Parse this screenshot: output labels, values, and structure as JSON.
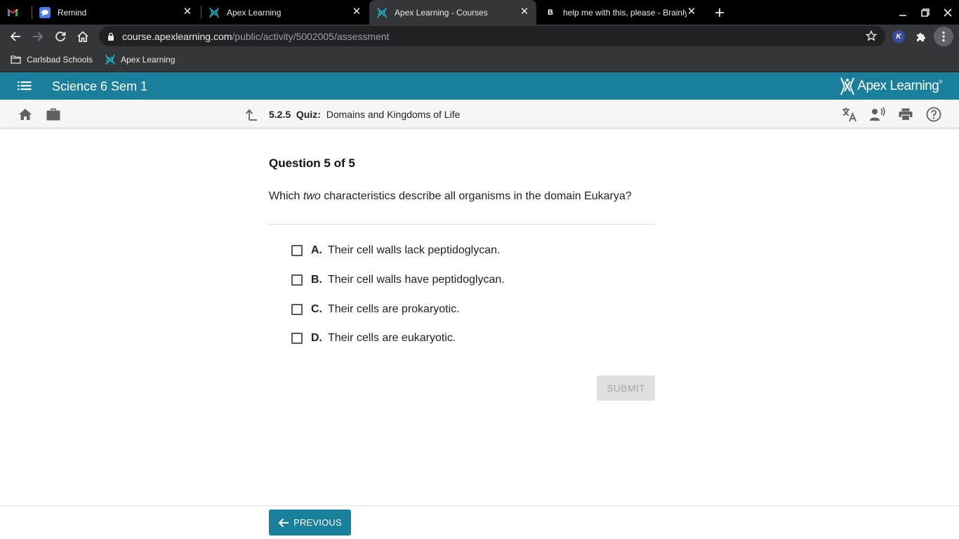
{
  "browser": {
    "tabs": [
      {
        "title": "",
        "icon": "gmail-icon"
      },
      {
        "title": "Remind",
        "icon": "remind-icon"
      },
      {
        "title": "Apex Learning",
        "icon": "apex-icon"
      },
      {
        "title": "Apex Learning - Courses",
        "icon": "apex-icon"
      },
      {
        "title": "help me with this, please - Brainly",
        "icon": "brainly-icon"
      }
    ],
    "url_host": "course.apexlearning.com",
    "url_path": "/public/activity/5002005/assessment",
    "bookmarks": [
      {
        "label": "Carlsbad Schools",
        "icon": "folder-icon"
      },
      {
        "label": "Apex Learning",
        "icon": "apex-icon"
      }
    ]
  },
  "app": {
    "course_title": "Science 6 Sem 1",
    "brand": "Apex Learning",
    "accent": "#1a7f9b"
  },
  "breadcrumb": {
    "number": "5.2.5",
    "type": "Quiz:",
    "title": "Domains and Kingdoms of Life"
  },
  "question": {
    "header": "Question 5 of 5",
    "text_before": "Which ",
    "text_emphasis": "two",
    "text_after": " characteristics describe all organisms in the domain Eukarya?",
    "options": [
      {
        "letter": "A.",
        "text": "Their cell walls lack peptidoglycan."
      },
      {
        "letter": "B.",
        "text": "Their cell walls have peptidoglycan."
      },
      {
        "letter": "C.",
        "text": "Their cells are prokaryotic."
      },
      {
        "letter": "D.",
        "text": "Their cells are eukaryotic."
      }
    ],
    "submit_label": "SUBMIT"
  },
  "footer": {
    "previous_label": "PREVIOUS"
  }
}
